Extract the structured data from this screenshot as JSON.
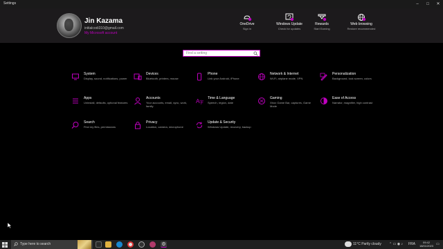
{
  "window": {
    "title": "Settings"
  },
  "account": {
    "name": "Jin Kazama",
    "email": "initialcodi310@gmail.com",
    "link": "My Microsoft account"
  },
  "header_items": [
    {
      "icon": "onedrive-icon",
      "title": "OneDrive",
      "subtitle": "Sign in"
    },
    {
      "icon": "windows-update-icon",
      "title": "Windows Update",
      "subtitle": "Check for updates"
    },
    {
      "icon": "rewards-icon",
      "title": "Rewards",
      "subtitle": "Start Earning"
    },
    {
      "icon": "web-browsing-icon",
      "title": "Web browsing",
      "subtitle": "Restore recommended"
    }
  ],
  "search": {
    "placeholder": "Find a setting"
  },
  "tiles": [
    {
      "icon": "system-icon",
      "title": "System",
      "desc": "Display, sound, notifications, power"
    },
    {
      "icon": "devices-icon",
      "title": "Devices",
      "desc": "Bluetooth, printers, mouse"
    },
    {
      "icon": "phone-icon",
      "title": "Phone",
      "desc": "Link your Android, iPhone"
    },
    {
      "icon": "network-icon",
      "title": "Network & Internet",
      "desc": "Wi-Fi, airplane mode, VPN"
    },
    {
      "icon": "personalization-icon",
      "title": "Personalization",
      "desc": "Background, lock screen, colors"
    },
    {
      "icon": "apps-icon",
      "title": "Apps",
      "desc": "Uninstall, defaults, optional features"
    },
    {
      "icon": "accounts-icon",
      "title": "Accounts",
      "desc": "Your accounts, email, sync, work, family"
    },
    {
      "icon": "time-language-icon",
      "title": "Time & Language",
      "desc": "Speech, region, date"
    },
    {
      "icon": "gaming-icon",
      "title": "Gaming",
      "desc": "Xbox Game Bar, captures, Game Mode"
    },
    {
      "icon": "ease-of-access-icon",
      "title": "Ease of Access",
      "desc": "Narrator, magnifier, high contrast"
    },
    {
      "icon": "search-icon",
      "title": "Search",
      "desc": "Find my files, permissions"
    },
    {
      "icon": "privacy-icon",
      "title": "Privacy",
      "desc": "Location, camera, microphone"
    },
    {
      "icon": "update-security-icon",
      "title": "Update & Security",
      "desc": "Windows Update, recovery, backup"
    }
  ],
  "taskbar": {
    "search_placeholder": "Type here to search",
    "weather": "11°C  Partly cloudy",
    "lang": "FRA",
    "time": "09:42",
    "date": "18/01/2023"
  },
  "colors": {
    "accent": "#c000c0",
    "background": "#000000",
    "header": "#1c1a1c"
  }
}
